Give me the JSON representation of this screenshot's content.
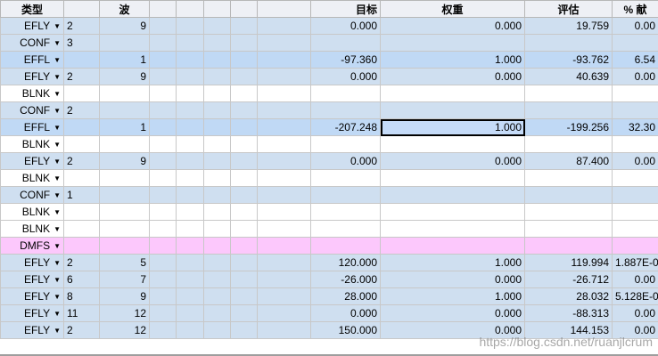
{
  "columns": [
    "类型",
    "",
    "波",
    "",
    "",
    "",
    "",
    "",
    "目标",
    "权重",
    "评估",
    "% 献"
  ],
  "rows": [
    {
      "type": "EFLY",
      "int1": "2",
      "wave": "9",
      "target": "0.000",
      "weight": "0.000",
      "eval": "19.759",
      "contrib": "0.00",
      "style": "blue"
    },
    {
      "type": "CONF",
      "int1": "3",
      "wave": "",
      "target": "",
      "weight": "",
      "eval": "",
      "contrib": "",
      "style": "blue"
    },
    {
      "type": "EFFL",
      "int1": "",
      "wave": "1",
      "target": "-97.360",
      "weight": "1.000",
      "eval": "-93.762",
      "contrib": "6.54",
      "style": "active"
    },
    {
      "type": "EFLY",
      "int1": "2",
      "wave": "9",
      "target": "0.000",
      "weight": "0.000",
      "eval": "40.639",
      "contrib": "0.00",
      "style": "blue"
    },
    {
      "type": "BLNK",
      "int1": "",
      "wave": "",
      "target": "",
      "weight": "",
      "eval": "",
      "contrib": "",
      "style": "white"
    },
    {
      "type": "CONF",
      "int1": "2",
      "wave": "",
      "target": "",
      "weight": "",
      "eval": "",
      "contrib": "",
      "style": "blue"
    },
    {
      "type": "EFFL",
      "int1": "",
      "wave": "1",
      "target": "-207.248",
      "weight": "1.000",
      "eval": "-199.256",
      "contrib": "32.30",
      "style": "active",
      "selected": "weight"
    },
    {
      "type": "BLNK",
      "int1": "",
      "wave": "",
      "target": "",
      "weight": "",
      "eval": "",
      "contrib": "",
      "style": "white"
    },
    {
      "type": "EFLY",
      "int1": "2",
      "wave": "9",
      "target": "0.000",
      "weight": "0.000",
      "eval": "87.400",
      "contrib": "0.00",
      "style": "blue"
    },
    {
      "type": "BLNK",
      "int1": "",
      "wave": "",
      "target": "",
      "weight": "",
      "eval": "",
      "contrib": "",
      "style": "white"
    },
    {
      "type": "CONF",
      "int1": "1",
      "wave": "",
      "target": "",
      "weight": "",
      "eval": "",
      "contrib": "",
      "style": "blue"
    },
    {
      "type": "BLNK",
      "int1": "",
      "wave": "",
      "target": "",
      "weight": "",
      "eval": "",
      "contrib": "",
      "style": "white"
    },
    {
      "type": "BLNK",
      "int1": "",
      "wave": "",
      "target": "",
      "weight": "",
      "eval": "",
      "contrib": "",
      "style": "white"
    },
    {
      "type": "DMFS",
      "int1": "",
      "wave": "",
      "target": "",
      "weight": "",
      "eval": "",
      "contrib": "",
      "style": "pink"
    },
    {
      "type": "EFLY",
      "int1": "2",
      "wave": "5",
      "target": "120.000",
      "weight": "1.000",
      "eval": "119.994",
      "contrib": "1.887E-0",
      "style": "blue"
    },
    {
      "type": "EFLY",
      "int1": "6",
      "wave": "7",
      "target": "-26.000",
      "weight": "0.000",
      "eval": "-26.712",
      "contrib": "0.00",
      "style": "blue"
    },
    {
      "type": "EFLY",
      "int1": "8",
      "wave": "9",
      "target": "28.000",
      "weight": "1.000",
      "eval": "28.032",
      "contrib": "5.128E-0",
      "style": "blue"
    },
    {
      "type": "EFLY",
      "int1": "11",
      "wave": "12",
      "target": "0.000",
      "weight": "0.000",
      "eval": "-88.313",
      "contrib": "0.00",
      "style": "blue"
    },
    {
      "type": "EFLY",
      "int1": "2",
      "wave": "12",
      "target": "150.000",
      "weight": "0.000",
      "eval": "144.153",
      "contrib": "0.00",
      "style": "blue"
    }
  ],
  "watermark": "https://blog.csdn.net/ruanjlcrum",
  "icons": {
    "dropdown": "caret-down-icon"
  }
}
